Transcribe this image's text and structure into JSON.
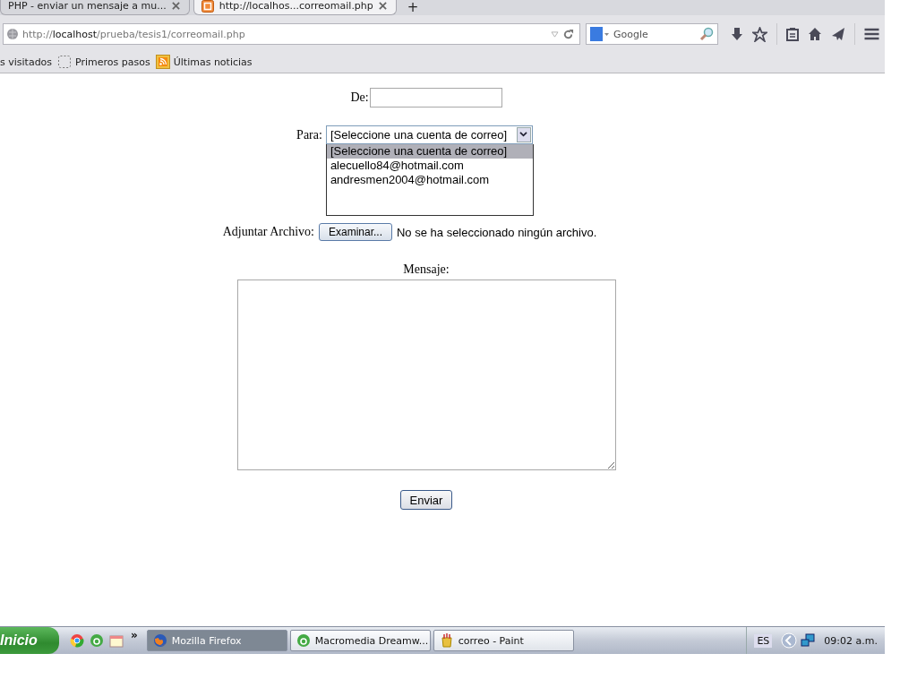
{
  "browser": {
    "tabs": [
      {
        "title": "PHP - enviar un mensaje a mu...",
        "selected": false
      },
      {
        "title": "http://localhos...correomail.php",
        "selected": true
      }
    ],
    "new_tab": "+",
    "url": {
      "prefix": "http://",
      "host": "localhost",
      "path": "/prueba/tesis1/correomail.php"
    },
    "search": {
      "engine": "Google"
    },
    "bookmarks": [
      {
        "label": "s visitados",
        "kind": "plain"
      },
      {
        "label": "Primeros pasos",
        "kind": "folder"
      },
      {
        "label": "Últimas noticias",
        "kind": "feed"
      }
    ]
  },
  "form": {
    "from": {
      "label": "De:"
    },
    "to": {
      "label": "Para:",
      "value": "[Seleccione una cuenta de correo]",
      "expanded": true,
      "options": [
        {
          "label": "[Seleccione una cuenta de correo]",
          "selected": true
        },
        {
          "label": "alecuello84@hotmail.com",
          "selected": false
        },
        {
          "label": "andresmen2004@hotmail.com",
          "selected": false
        }
      ]
    },
    "attachment": {
      "label": "Adjuntar Archivo:",
      "button": "Examinar...",
      "status": "No se ha seleccionado ningún archivo."
    },
    "message": {
      "label": "Mensaje:"
    },
    "submit": "Enviar"
  },
  "taskbar": {
    "start": "Inicio",
    "more": "»",
    "tasks": [
      {
        "label": "Mozilla Firefox",
        "kind": "firefox",
        "selected": true
      },
      {
        "label": "Macromedia Dreamw...",
        "kind": "dreamweaver",
        "selected": false
      },
      {
        "label": "correo - Paint",
        "kind": "paint",
        "selected": false
      }
    ],
    "language": "ES",
    "clock": "09:02 a.m."
  }
}
